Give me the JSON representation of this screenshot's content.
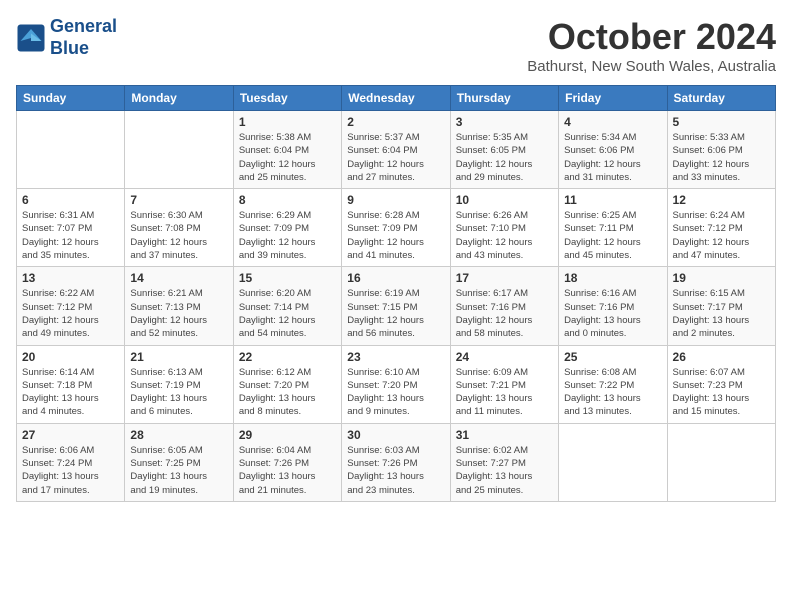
{
  "logo": {
    "line1": "General",
    "line2": "Blue"
  },
  "title": "October 2024",
  "subtitle": "Bathurst, New South Wales, Australia",
  "days_of_week": [
    "Sunday",
    "Monday",
    "Tuesday",
    "Wednesday",
    "Thursday",
    "Friday",
    "Saturday"
  ],
  "weeks": [
    [
      {
        "day": "",
        "detail": ""
      },
      {
        "day": "",
        "detail": ""
      },
      {
        "day": "1",
        "detail": "Sunrise: 5:38 AM\nSunset: 6:04 PM\nDaylight: 12 hours\nand 25 minutes."
      },
      {
        "day": "2",
        "detail": "Sunrise: 5:37 AM\nSunset: 6:04 PM\nDaylight: 12 hours\nand 27 minutes."
      },
      {
        "day": "3",
        "detail": "Sunrise: 5:35 AM\nSunset: 6:05 PM\nDaylight: 12 hours\nand 29 minutes."
      },
      {
        "day": "4",
        "detail": "Sunrise: 5:34 AM\nSunset: 6:06 PM\nDaylight: 12 hours\nand 31 minutes."
      },
      {
        "day": "5",
        "detail": "Sunrise: 5:33 AM\nSunset: 6:06 PM\nDaylight: 12 hours\nand 33 minutes."
      }
    ],
    [
      {
        "day": "6",
        "detail": "Sunrise: 6:31 AM\nSunset: 7:07 PM\nDaylight: 12 hours\nand 35 minutes."
      },
      {
        "day": "7",
        "detail": "Sunrise: 6:30 AM\nSunset: 7:08 PM\nDaylight: 12 hours\nand 37 minutes."
      },
      {
        "day": "8",
        "detail": "Sunrise: 6:29 AM\nSunset: 7:09 PM\nDaylight: 12 hours\nand 39 minutes."
      },
      {
        "day": "9",
        "detail": "Sunrise: 6:28 AM\nSunset: 7:09 PM\nDaylight: 12 hours\nand 41 minutes."
      },
      {
        "day": "10",
        "detail": "Sunrise: 6:26 AM\nSunset: 7:10 PM\nDaylight: 12 hours\nand 43 minutes."
      },
      {
        "day": "11",
        "detail": "Sunrise: 6:25 AM\nSunset: 7:11 PM\nDaylight: 12 hours\nand 45 minutes."
      },
      {
        "day": "12",
        "detail": "Sunrise: 6:24 AM\nSunset: 7:12 PM\nDaylight: 12 hours\nand 47 minutes."
      }
    ],
    [
      {
        "day": "13",
        "detail": "Sunrise: 6:22 AM\nSunset: 7:12 PM\nDaylight: 12 hours\nand 49 minutes."
      },
      {
        "day": "14",
        "detail": "Sunrise: 6:21 AM\nSunset: 7:13 PM\nDaylight: 12 hours\nand 52 minutes."
      },
      {
        "day": "15",
        "detail": "Sunrise: 6:20 AM\nSunset: 7:14 PM\nDaylight: 12 hours\nand 54 minutes."
      },
      {
        "day": "16",
        "detail": "Sunrise: 6:19 AM\nSunset: 7:15 PM\nDaylight: 12 hours\nand 56 minutes."
      },
      {
        "day": "17",
        "detail": "Sunrise: 6:17 AM\nSunset: 7:16 PM\nDaylight: 12 hours\nand 58 minutes."
      },
      {
        "day": "18",
        "detail": "Sunrise: 6:16 AM\nSunset: 7:16 PM\nDaylight: 13 hours\nand 0 minutes."
      },
      {
        "day": "19",
        "detail": "Sunrise: 6:15 AM\nSunset: 7:17 PM\nDaylight: 13 hours\nand 2 minutes."
      }
    ],
    [
      {
        "day": "20",
        "detail": "Sunrise: 6:14 AM\nSunset: 7:18 PM\nDaylight: 13 hours\nand 4 minutes."
      },
      {
        "day": "21",
        "detail": "Sunrise: 6:13 AM\nSunset: 7:19 PM\nDaylight: 13 hours\nand 6 minutes."
      },
      {
        "day": "22",
        "detail": "Sunrise: 6:12 AM\nSunset: 7:20 PM\nDaylight: 13 hours\nand 8 minutes."
      },
      {
        "day": "23",
        "detail": "Sunrise: 6:10 AM\nSunset: 7:20 PM\nDaylight: 13 hours\nand 9 minutes."
      },
      {
        "day": "24",
        "detail": "Sunrise: 6:09 AM\nSunset: 7:21 PM\nDaylight: 13 hours\nand 11 minutes."
      },
      {
        "day": "25",
        "detail": "Sunrise: 6:08 AM\nSunset: 7:22 PM\nDaylight: 13 hours\nand 13 minutes."
      },
      {
        "day": "26",
        "detail": "Sunrise: 6:07 AM\nSunset: 7:23 PM\nDaylight: 13 hours\nand 15 minutes."
      }
    ],
    [
      {
        "day": "27",
        "detail": "Sunrise: 6:06 AM\nSunset: 7:24 PM\nDaylight: 13 hours\nand 17 minutes."
      },
      {
        "day": "28",
        "detail": "Sunrise: 6:05 AM\nSunset: 7:25 PM\nDaylight: 13 hours\nand 19 minutes."
      },
      {
        "day": "29",
        "detail": "Sunrise: 6:04 AM\nSunset: 7:26 PM\nDaylight: 13 hours\nand 21 minutes."
      },
      {
        "day": "30",
        "detail": "Sunrise: 6:03 AM\nSunset: 7:26 PM\nDaylight: 13 hours\nand 23 minutes."
      },
      {
        "day": "31",
        "detail": "Sunrise: 6:02 AM\nSunset: 7:27 PM\nDaylight: 13 hours\nand 25 minutes."
      },
      {
        "day": "",
        "detail": ""
      },
      {
        "day": "",
        "detail": ""
      }
    ]
  ]
}
